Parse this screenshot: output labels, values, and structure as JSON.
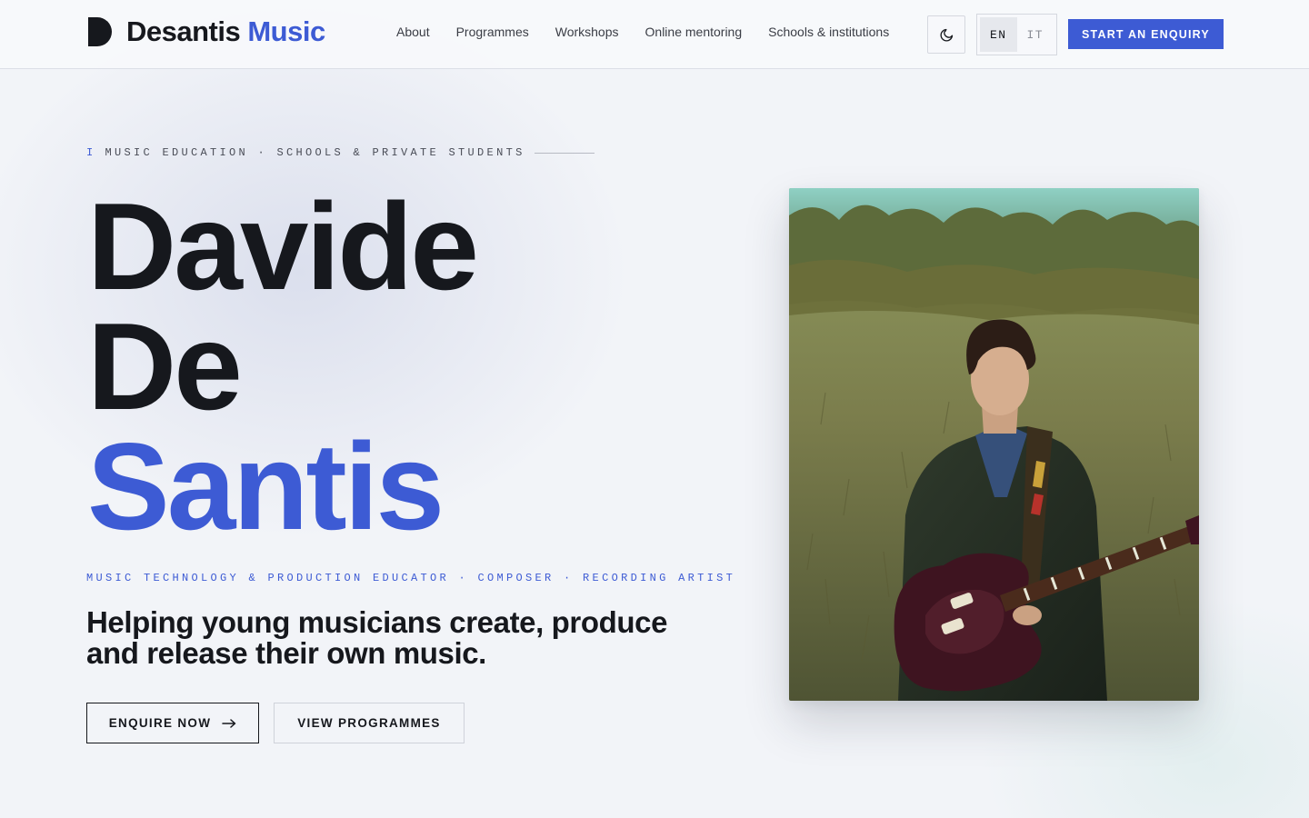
{
  "header": {
    "brand": {
      "name_part1": "Desantis",
      "name_part2": "Music",
      "logo_icon": "d-logo-icon"
    },
    "nav": [
      {
        "label": "About"
      },
      {
        "label": "Programmes"
      },
      {
        "label": "Workshops"
      },
      {
        "label": "Online mentoring"
      },
      {
        "label": "Schools & institutions"
      }
    ],
    "theme_toggle_icon": "moon-icon",
    "languages": {
      "active": "EN",
      "other": "IT"
    },
    "cta_label": "START AN ENQUIRY"
  },
  "hero": {
    "eyebrow_number": "I",
    "eyebrow_text": "MUSIC EDUCATION · SCHOOLS & PRIVATE STUDENTS",
    "name_line1": "Davide",
    "name_line2": "De",
    "name_line3": "Santis",
    "roles": "MUSIC TECHNOLOGY & PRODUCTION EDUCATOR · COMPOSER · RECORDING ARTIST",
    "tagline": "Helping young musicians create, produce and release their own music.",
    "primary_button": "ENQUIRE NOW",
    "primary_button_icon": "arrow-right-icon",
    "secondary_button": "VIEW PROGRAMMES"
  },
  "colors": {
    "accent": "#3d5bd4",
    "text": "#16181d",
    "background": "#f2f4f8"
  }
}
